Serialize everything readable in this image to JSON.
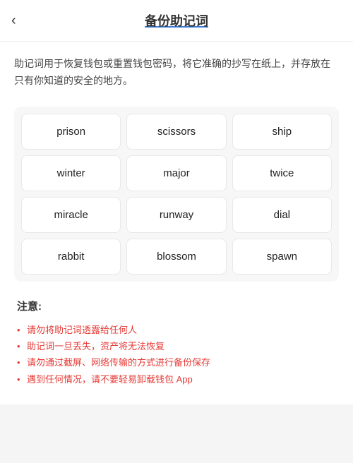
{
  "header": {
    "back_label": "‹",
    "title": "备份助记词"
  },
  "description": "助记词用于恢复钱包或重置钱包密码，将它准确的抄写在纸上，并存放在只有你知道的安全的地方。",
  "mnemonic_words": [
    "prison",
    "scissors",
    "ship",
    "winter",
    "major",
    "twice",
    "miracle",
    "runway",
    "dial",
    "rabbit",
    "blossom",
    "spawn"
  ],
  "notice": {
    "title": "注意:",
    "items": [
      "请勿将助记词透露给任何人",
      "助记词一旦丢失，资产将无法恢复",
      "请勿通过截屏、网络传输的方式进行备份保存",
      "遇到任何情况，请不要轻易卸载钱包 App"
    ]
  }
}
